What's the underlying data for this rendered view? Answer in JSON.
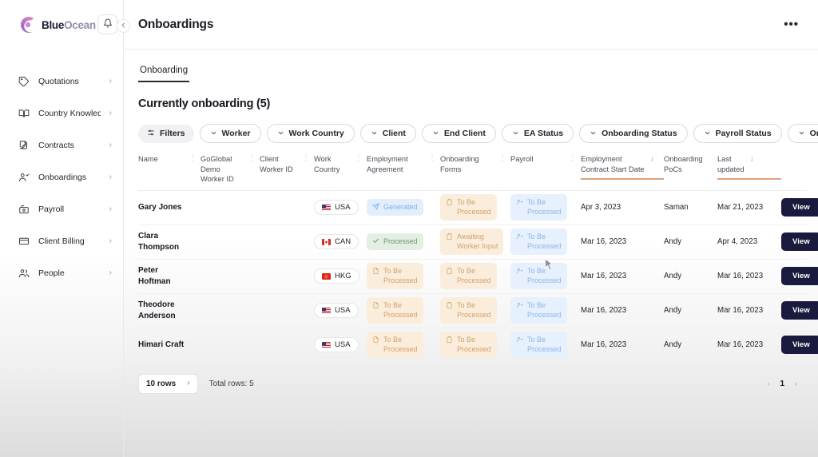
{
  "brand": {
    "name_part1": "Blue",
    "name_part2": "Ocean",
    "logo_icon": "bluocean-swirl-logo",
    "bell_icon": "bell-icon"
  },
  "sidebar": {
    "items": [
      {
        "label": "Quotations",
        "icon": "tag-icon",
        "chevron": "›"
      },
      {
        "label": "Country Knowled...",
        "icon": "book-icon",
        "chevron": "›"
      },
      {
        "label": "Contracts",
        "icon": "contract-icon",
        "chevron": "›"
      },
      {
        "label": "Onboardings",
        "icon": "user-check-icon",
        "chevron": "›"
      },
      {
        "label": "Payroll",
        "icon": "payroll-icon",
        "chevron": "›"
      },
      {
        "label": "Client Billing",
        "icon": "card-icon",
        "chevron": "›"
      },
      {
        "label": "People",
        "icon": "people-icon",
        "chevron": "›"
      }
    ]
  },
  "topbar": {
    "title": "Onboardings",
    "collapse_icon": "chevron-left-icon",
    "more_label": "•••"
  },
  "tabs": [
    {
      "label": "Onboarding",
      "active": true
    }
  ],
  "section": {
    "heading": "Currently onboarding (5)"
  },
  "filters": {
    "filters_label": "Filters",
    "filters_icon": "sliders-icon",
    "pills": [
      "Worker",
      "Work Country",
      "Client",
      "End Client",
      "EA Status",
      "Onboarding Status",
      "Payroll Status",
      "Onboarding PoCs"
    ]
  },
  "table": {
    "columns": [
      {
        "line1": "Name",
        "line2": "",
        "sortable": true,
        "sorted": false
      },
      {
        "line1": "GoGlobal Demo",
        "line2": "Worker ID",
        "sortable": true,
        "sorted": false
      },
      {
        "line1": "Client",
        "line2": "Worker ID",
        "sortable": true,
        "sorted": false
      },
      {
        "line1": "Work",
        "line2": "Country",
        "sortable": true,
        "sorted": false
      },
      {
        "line1": "Employment",
        "line2": "Agreement",
        "sortable": true,
        "sorted": false
      },
      {
        "line1": "Onboarding",
        "line2": "Forms",
        "sortable": true,
        "sorted": false
      },
      {
        "line1": "Payroll",
        "line2": "",
        "sortable": true,
        "sorted": false
      },
      {
        "line1": "Employment",
        "line2": "Contract Start Date",
        "sortable": false,
        "sorted": true,
        "sort_dir": "↓"
      },
      {
        "line1": "Onboarding",
        "line2": "PoCs",
        "sortable": false,
        "sorted": false
      },
      {
        "line1": "Last",
        "line2": "updated",
        "sortable": false,
        "sorted": true,
        "sort_dir": "↓"
      },
      {
        "line1": "",
        "line2": "",
        "sortable": false,
        "sorted": false
      }
    ],
    "sort_handle": "⋮",
    "rows": [
      {
        "name": "Gary Jones",
        "name_l2": "",
        "goglobal_worker_id": "",
        "client_worker_id": "",
        "work_country": "USA",
        "flag": "us",
        "employment_agreement": {
          "text": "Generated",
          "text_l2": "",
          "style": "b-blue",
          "icon": "send-icon"
        },
        "onboarding_forms": {
          "text": "To Be",
          "text_l2": "Processed",
          "style": "b-orange",
          "icon": "clipboard-icon"
        },
        "payroll": {
          "text": "To Be",
          "text_l2": "Processed",
          "style": "b-lblue",
          "icon": "user-arrow-icon"
        },
        "contract_start_date": "Apr 3, 2023",
        "onboarding_pocs": "Saman",
        "last_updated": "Mar 21, 2023",
        "view_label": "View"
      },
      {
        "name": "Clara",
        "name_l2": "Thompson",
        "goglobal_worker_id": "",
        "client_worker_id": "",
        "work_country": "CAN",
        "flag": "ca",
        "employment_agreement": {
          "text": "Processed",
          "text_l2": "",
          "style": "b-green",
          "icon": "check-icon"
        },
        "onboarding_forms": {
          "text": "Awaiting",
          "text_l2": "Worker Input",
          "style": "b-orange",
          "icon": "clipboard-icon"
        },
        "payroll": {
          "text": "To Be",
          "text_l2": "Processed",
          "style": "b-lblue",
          "icon": "user-arrow-icon"
        },
        "contract_start_date": "Mar 16, 2023",
        "onboarding_pocs": "Andy",
        "last_updated": "Apr 4, 2023",
        "view_label": "View"
      },
      {
        "name": "Peter",
        "name_l2": "Hoftman",
        "goglobal_worker_id": "",
        "client_worker_id": "",
        "work_country": "HKG",
        "flag": "hk",
        "employment_agreement": {
          "text": "To Be",
          "text_l2": "Processed",
          "style": "b-orange",
          "icon": "doc-icon"
        },
        "onboarding_forms": {
          "text": "To Be",
          "text_l2": "Processed",
          "style": "b-orange",
          "icon": "clipboard-icon"
        },
        "payroll": {
          "text": "To Be",
          "text_l2": "Processed",
          "style": "b-lblue",
          "icon": "user-arrow-icon"
        },
        "contract_start_date": "Mar 16, 2023",
        "onboarding_pocs": "Andy",
        "last_updated": "Mar 16, 2023",
        "view_label": "View"
      },
      {
        "name": "Theodore",
        "name_l2": "Anderson",
        "goglobal_worker_id": "",
        "client_worker_id": "",
        "work_country": "USA",
        "flag": "us",
        "employment_agreement": {
          "text": "To Be",
          "text_l2": "Processed",
          "style": "b-orange",
          "icon": "doc-icon"
        },
        "onboarding_forms": {
          "text": "To Be",
          "text_l2": "Processed",
          "style": "b-orange",
          "icon": "clipboard-icon"
        },
        "payroll": {
          "text": "To Be",
          "text_l2": "Processed",
          "style": "b-lblue",
          "icon": "user-arrow-icon"
        },
        "contract_start_date": "Mar 16, 2023",
        "onboarding_pocs": "Andy",
        "last_updated": "Mar 16, 2023",
        "view_label": "View"
      },
      {
        "name": "Himari Craft",
        "name_l2": "",
        "goglobal_worker_id": "",
        "client_worker_id": "",
        "work_country": "USA",
        "flag": "us",
        "employment_agreement": {
          "text": "To Be",
          "text_l2": "Processed",
          "style": "b-orange",
          "icon": "doc-icon"
        },
        "onboarding_forms": {
          "text": "To Be",
          "text_l2": "Processed",
          "style": "b-orange",
          "icon": "clipboard-icon"
        },
        "payroll": {
          "text": "To Be",
          "text_l2": "Processed",
          "style": "b-lblue",
          "icon": "user-arrow-icon"
        },
        "contract_start_date": "Mar 16, 2023",
        "onboarding_pocs": "Andy",
        "last_updated": "Mar 16, 2023",
        "view_label": "View"
      }
    ]
  },
  "footer": {
    "rows_per_page": "10 rows",
    "rows_chevron": "›",
    "total_rows": "Total rows: 5",
    "prev_icon": "‹",
    "page_number": "1",
    "next_icon": "›"
  },
  "colors": {
    "accent_navy": "#191a3d",
    "sort_orange": "#e08a5e",
    "badge_blue": "#e2eefc",
    "badge_green": "#e4efe4",
    "badge_orange": "#fbeddc"
  }
}
